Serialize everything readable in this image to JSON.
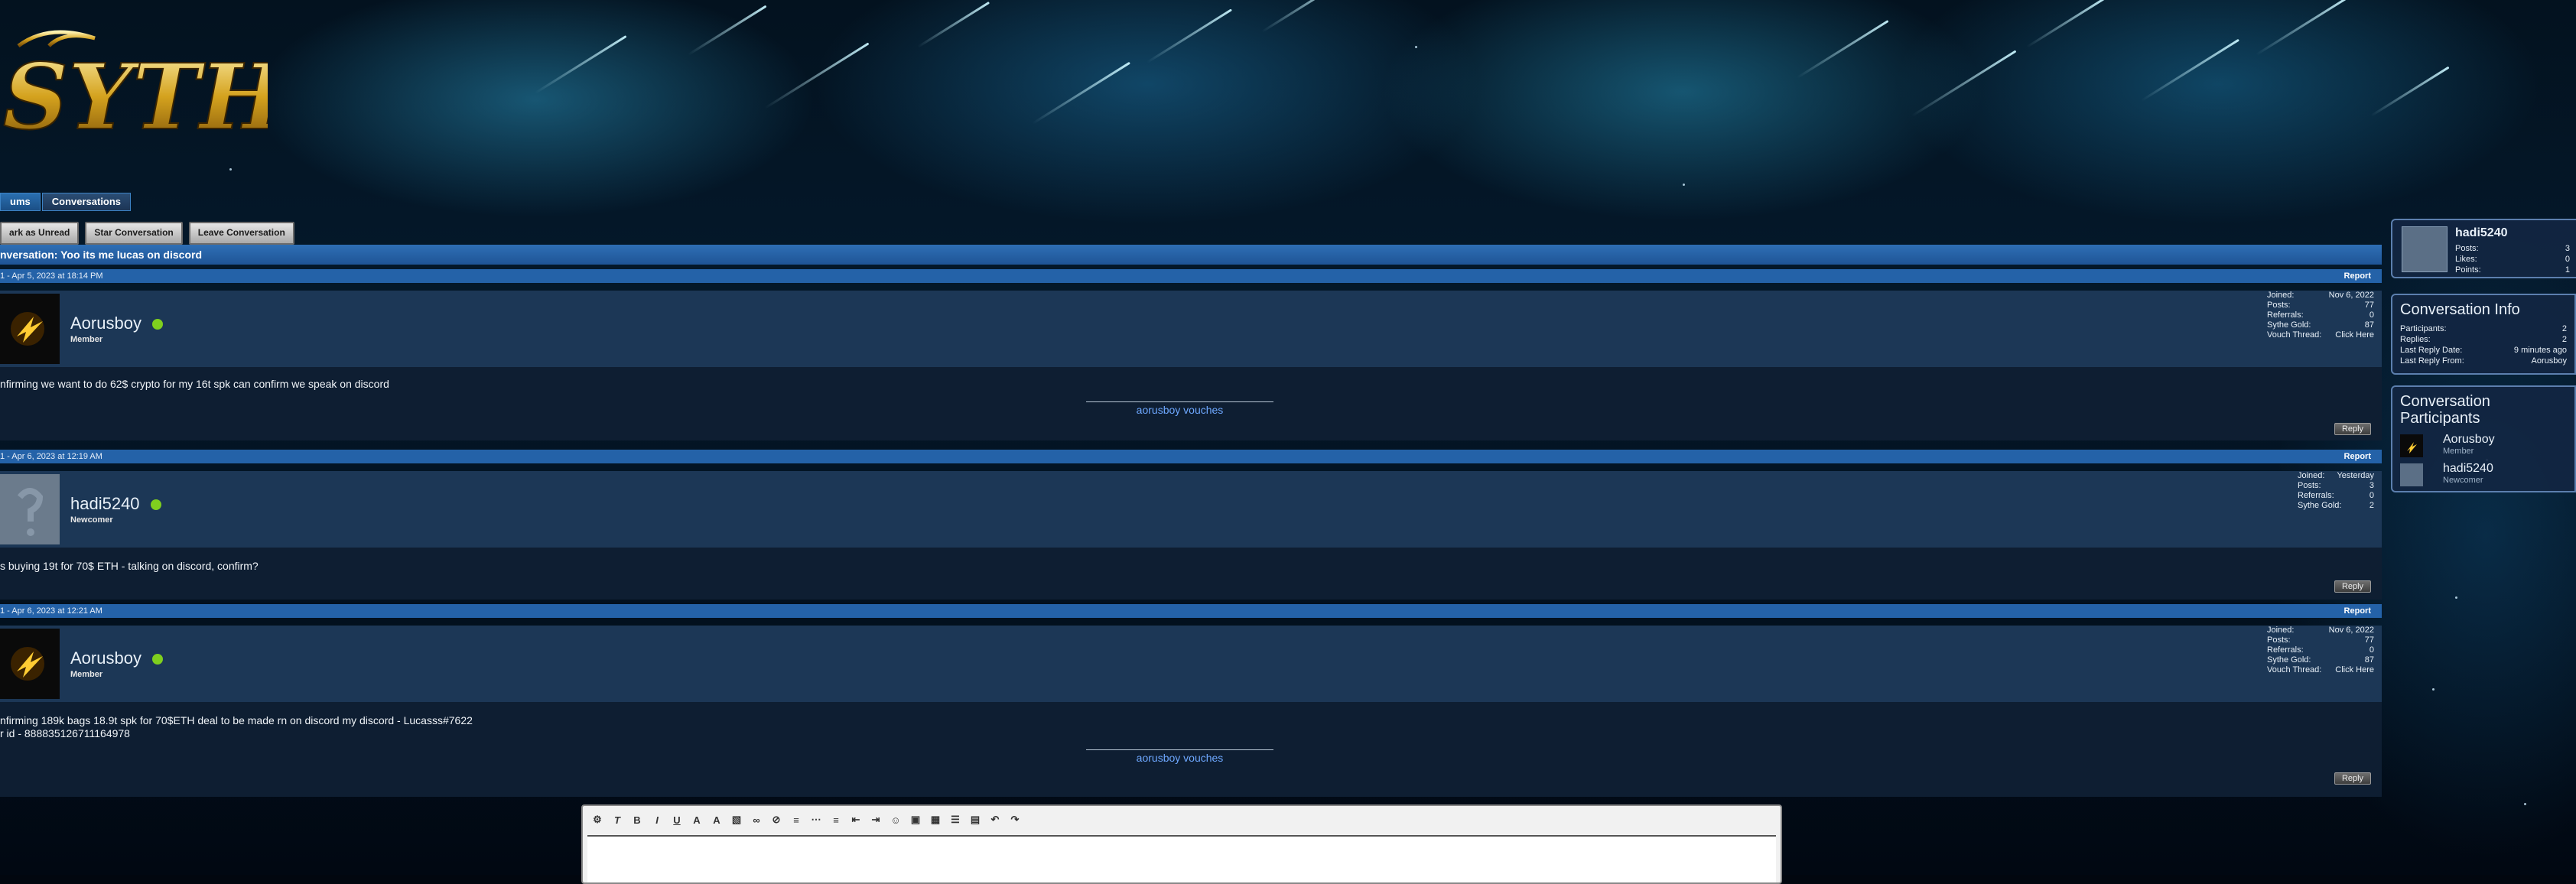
{
  "site": {
    "logo_text": "SYTHE"
  },
  "breadcrumb": {
    "items": [
      "ums",
      "Conversations"
    ]
  },
  "actions": {
    "mark_unread": "ark as Unread",
    "star": "Star Conversation",
    "leave": "Leave Conversation"
  },
  "conversation": {
    "title": "nversation: Yoo its me lucas on discord"
  },
  "report_label": "Report",
  "reply_label": "Reply",
  "messages": [
    {
      "meta": "1 - Apr 5, 2023 at 18:14 PM",
      "username": "Aorusboy",
      "user_title": "Member",
      "stats": [
        [
          "Joined:",
          "Nov 6, 2022"
        ],
        [
          "Posts:",
          "77"
        ],
        [
          "Referrals:",
          "0"
        ],
        [
          "Sythe Gold:",
          "87"
        ],
        [
          "Vouch Thread:",
          "Click Here"
        ]
      ],
      "body": "nfirming we want to do 62$ crypto for my 16t spk can confirm we speak on discord",
      "signature": "aorusboy vouches"
    },
    {
      "meta": "1 - Apr 6, 2023 at 12:19 AM",
      "username": "hadi5240",
      "user_title": "Newcomer",
      "stats": [
        [
          "Joined:",
          "Yesterday"
        ],
        [
          "Posts:",
          "3"
        ],
        [
          "Referrals:",
          "0"
        ],
        [
          "Sythe Gold:",
          "2"
        ]
      ],
      "body": "s buying 19t for 70$ ETH - talking on discord, confirm?",
      "signature": ""
    },
    {
      "meta": "1 - Apr 6, 2023 at 12:21 AM",
      "username": "Aorusboy",
      "user_title": "Member",
      "stats": [
        [
          "Joined:",
          "Nov 6, 2022"
        ],
        [
          "Posts:",
          "77"
        ],
        [
          "Referrals:",
          "0"
        ],
        [
          "Sythe Gold:",
          "87"
        ],
        [
          "Vouch Thread:",
          "Click Here"
        ]
      ],
      "body": "nfirming 189k bags 18.9t spk for 70$ETH deal to be made rn on discord my discord - Lucasss#7622\nr id - 888835126711164978",
      "signature": "aorusboy vouches"
    }
  ],
  "sidebar": {
    "profile": {
      "name": "hadi5240",
      "stats": [
        [
          "Posts:",
          "3"
        ],
        [
          "Likes:",
          "0"
        ],
        [
          "Points:",
          "1"
        ]
      ]
    },
    "info": {
      "title": "Conversation Info",
      "rows": [
        [
          "Participants:",
          "2"
        ],
        [
          "Replies:",
          "2"
        ],
        [
          "Last Reply Date:",
          "9 minutes ago"
        ],
        [
          "Last Reply From:",
          "Aorusboy"
        ]
      ]
    },
    "participants": {
      "title": "Conversation Participants",
      "list": [
        {
          "name": "Aorusboy",
          "role": "Member"
        },
        {
          "name": "hadi5240",
          "role": "Newcomer"
        }
      ]
    }
  },
  "colors": {
    "accent": "#2462a8",
    "online": "#7fcf1e",
    "link": "#6ea8ff"
  }
}
